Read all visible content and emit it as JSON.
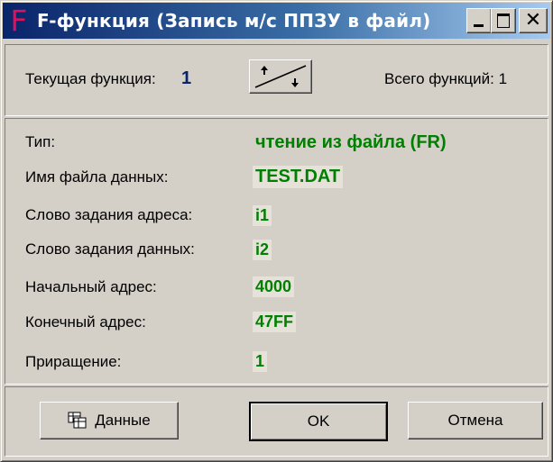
{
  "window": {
    "title": "F-функция (Запись м/с ППЗУ в файл)",
    "icon_letter": "F",
    "controls": {
      "minimize": "minimize-icon",
      "maximize": "maximize-icon",
      "close": "✕"
    }
  },
  "header": {
    "current_function_label": "Текущая функция:",
    "current_function_value": "1",
    "total_functions": "Всего функций: 1"
  },
  "fields": [
    {
      "label": "Тип:",
      "value": "чтение из файла (FR)"
    },
    {
      "label": "Имя файла данных:",
      "value": "TEST.DAT"
    },
    {
      "label": "Слово задания адреса:",
      "value": "i1"
    },
    {
      "label": "Слово задания данных:",
      "value": "i2"
    },
    {
      "label": "Начальный адрес:",
      "value": "4000"
    },
    {
      "label": "Конечный адрес:",
      "value": "47FF"
    },
    {
      "label": "Приращение:",
      "value": "1"
    }
  ],
  "buttons": {
    "data": "Данные",
    "ok": "OK",
    "cancel": "Отмена"
  },
  "colors": {
    "value_green": "#008000",
    "value_blue": "#0a246a",
    "title_gradient_start": "#0a246a",
    "title_gradient_end": "#a6caf0",
    "icon_pink": "#e0105a",
    "face": "#d4d0c8"
  }
}
